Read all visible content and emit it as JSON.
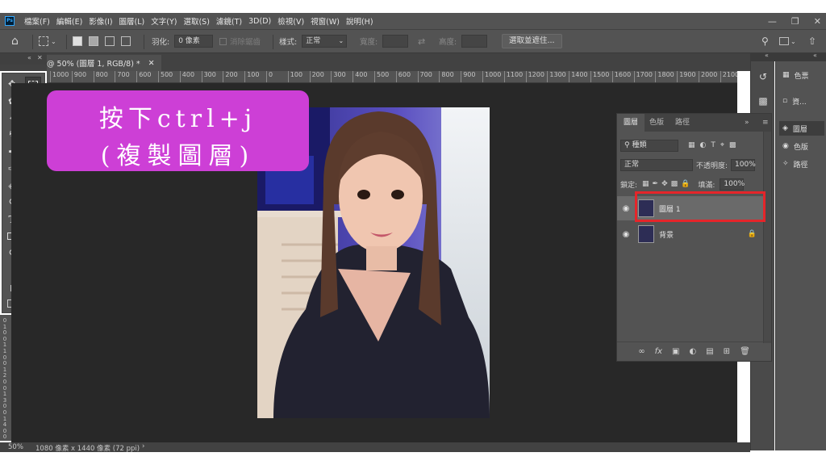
{
  "app": {
    "logo": "Ps"
  },
  "menubar": {
    "items": [
      "檔案(F)",
      "編輯(E)",
      "影像(I)",
      "圖層(L)",
      "文字(Y)",
      "選取(S)",
      "濾鏡(T)",
      "3D(D)",
      "檢視(V)",
      "視窗(W)",
      "說明(H)"
    ]
  },
  "options": {
    "feather_label": "羽化:",
    "feather_value": "0 像素",
    "antialias_label": "消除鋸齒",
    "style_label": "樣式:",
    "style_value": "正常",
    "width_label": "寬度:",
    "height_label": "高度:",
    "select_mask_button": "選取並遮住..."
  },
  "document": {
    "tab_title": "@ 50% (圖層 1, RGB/8) *",
    "zoom": "50%",
    "info": "1080 像素 x 1440 像素 (72 ppi)"
  },
  "ruler": {
    "top": [
      "1000",
      "900",
      "800",
      "700",
      "600",
      "500",
      "400",
      "300",
      "200",
      "100",
      "0",
      "100",
      "200",
      "300",
      "400",
      "500",
      "600",
      "700",
      "800",
      "900",
      "1000",
      "1100",
      "1200",
      "1300",
      "1400",
      "1500",
      "1600",
      "1700",
      "1800",
      "1900",
      "2000",
      "2100",
      "2"
    ],
    "left": [
      "0",
      "1",
      "0",
      "0",
      "1",
      "1",
      "0",
      "0",
      "1",
      "2",
      "0",
      "0",
      "1",
      "3",
      "0",
      "0",
      "1",
      "4",
      "0",
      "0"
    ]
  },
  "callout": {
    "line1": "按下ctrl+j",
    "line2": "(複製圖層)"
  },
  "layers_panel": {
    "tabs": [
      "圖層",
      "色版",
      "路徑"
    ],
    "filter_label": "種類",
    "blend_mode": "正常",
    "opacity_label": "不透明度:",
    "opacity_value": "100%",
    "lock_label": "鎖定:",
    "fill_label": "填滿:",
    "fill_value": "100%",
    "layers": [
      {
        "name": "圖層 1",
        "selected": true
      },
      {
        "name": "背景",
        "selected": false,
        "locked": true
      }
    ],
    "footer_fx": "fx"
  },
  "right_dock": {
    "items": [
      "色票",
      "資...",
      "圖層",
      "色版",
      "路徑"
    ]
  },
  "colors": {
    "highlight": "#e5252a",
    "callout_bg": "#cd3fd6",
    "panel_bg": "#535353"
  }
}
